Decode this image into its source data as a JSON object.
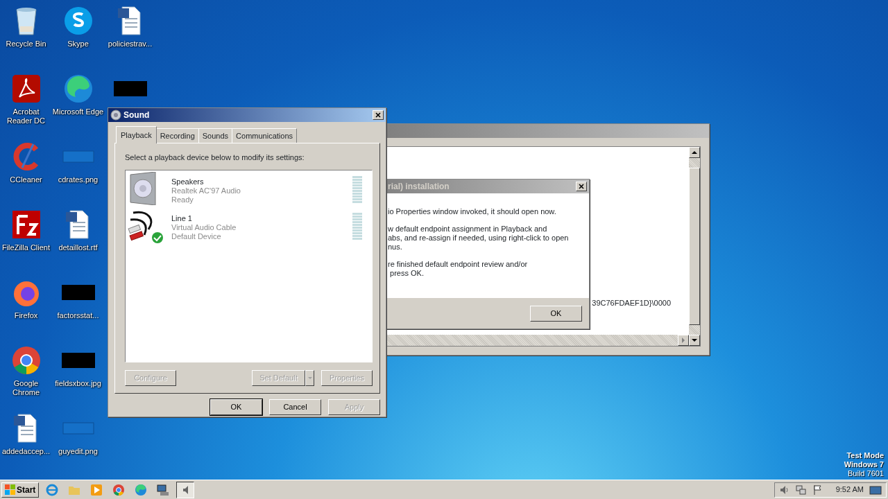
{
  "desktop_icons": [
    [
      {
        "label": "Recycle Bin",
        "kind": "recycle"
      },
      {
        "label": "Skype",
        "kind": "skype"
      },
      {
        "label": "policiestrav...",
        "kind": "word"
      }
    ],
    [
      {
        "label": "Acrobat Reader DC",
        "kind": "acrobat"
      },
      {
        "label": "Microsoft Edge",
        "kind": "edge"
      },
      {
        "kind": "redacted"
      }
    ],
    [
      {
        "label": "CCleaner",
        "kind": "ccleaner"
      },
      {
        "label": "cdrates.png",
        "kind": "blank"
      }
    ],
    [
      {
        "label": "FileZilla Client",
        "kind": "filezilla"
      },
      {
        "label": "detaillost.rtf",
        "kind": "word"
      }
    ],
    [
      {
        "label": "Firefox",
        "kind": "firefox"
      },
      {
        "label": "factorsstat...",
        "kind": "redacted"
      }
    ],
    [
      {
        "label": "Google Chrome",
        "kind": "chrome"
      },
      {
        "label": "fieldsxbox.jpg",
        "kind": "redacted"
      }
    ],
    [
      {
        "label": "addedaccep...",
        "kind": "word"
      },
      {
        "label": "guyedit.png",
        "kind": "blank"
      }
    ]
  ],
  "back_window": {
    "text": "39C76FDAEF1D}\\0000"
  },
  "installer_dialog": {
    "title": "rial) installation",
    "paragraphs": [
      "io Properties window invoked, it should open now.",
      "w default endpoint assignment in Playback and\nabs, and re-assign if needed, using right-click to open\nnus.",
      "re finished default endpoint review and/or\n press OK."
    ],
    "ok": "OK"
  },
  "sound_window": {
    "title": "Sound",
    "tabs": [
      {
        "label": "Playback",
        "selected": true
      },
      {
        "label": "Recording",
        "selected": false
      },
      {
        "label": "Sounds",
        "selected": false
      },
      {
        "label": "Communications",
        "selected": false
      }
    ],
    "instruction": "Select a playback device below to modify its settings:",
    "devices": [
      {
        "name": "Speakers",
        "driver": "Realtek AC'97 Audio",
        "status": "Ready",
        "kind": "speaker",
        "default": false
      },
      {
        "name": "Line 1",
        "driver": "Virtual Audio Cable",
        "status": "Default Device",
        "kind": "cable",
        "default": true
      }
    ],
    "device_buttons": [
      {
        "label": "Configure",
        "disabled": true,
        "split": false
      },
      {
        "label": "Set Default",
        "disabled": true,
        "split": true
      },
      {
        "label": "Properties",
        "disabled": true,
        "split": false
      }
    ],
    "dialog_buttons": [
      {
        "label": "OK",
        "disabled": false,
        "default": true
      },
      {
        "label": "Cancel",
        "disabled": false,
        "default": false
      },
      {
        "label": "Apply",
        "disabled": true,
        "default": false
      }
    ]
  },
  "os_notice": [
    "Test Mode",
    "Windows 7",
    "Build 7601"
  ],
  "taskbar": {
    "start": "Start",
    "apps": [
      {
        "kind": "ie",
        "active": false
      },
      {
        "kind": "folder",
        "active": false
      },
      {
        "kind": "media",
        "active": false
      },
      {
        "kind": "chrome",
        "active": false
      },
      {
        "kind": "edge",
        "active": false
      },
      {
        "kind": "app",
        "active": false
      },
      {
        "kind": "sound",
        "active": true
      }
    ],
    "clock": "9:52 AM"
  }
}
